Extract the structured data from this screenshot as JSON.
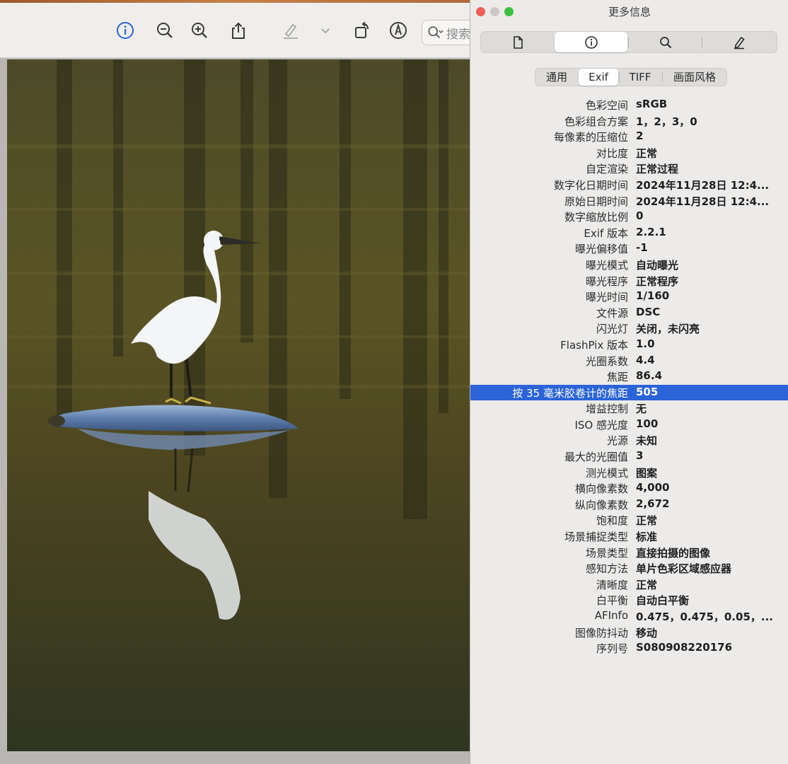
{
  "preview": {
    "search_placeholder": "搜索",
    "toolbar_icons": [
      "info-icon",
      "zoom-out-icon",
      "zoom-in-icon",
      "share-icon",
      "highlight-pen-icon",
      "chevron-down-icon",
      "rotate-icon",
      "markup-icon",
      "search-icon"
    ],
    "photo_description_icon": "egret-photo"
  },
  "inspector": {
    "title": "更多信息",
    "icon_tabs": [
      "document-icon",
      "info-icon",
      "magnifier-icon",
      "pencil-icon"
    ],
    "active_icon_tab": 1,
    "segments": [
      "通用",
      "Exif",
      "TIFF",
      "画面风格"
    ],
    "active_segment": 1,
    "rows": [
      {
        "k": "色彩空间",
        "v": "sRGB"
      },
      {
        "k": "色彩组合方案",
        "v": "1，2，3，0"
      },
      {
        "k": "每像素的压缩位",
        "v": "2"
      },
      {
        "k": "对比度",
        "v": "正常"
      },
      {
        "k": "自定渲染",
        "v": "正常过程"
      },
      {
        "k": "数字化日期时间",
        "v": "2024年11月28日 12:4..."
      },
      {
        "k": "原始日期时间",
        "v": "2024年11月28日 12:4..."
      },
      {
        "k": "数字缩放比例",
        "v": "0"
      },
      {
        "k": "Exif 版本",
        "v": "2.2.1"
      },
      {
        "k": "曝光偏移值",
        "v": "-1"
      },
      {
        "k": "曝光模式",
        "v": "自动曝光"
      },
      {
        "k": "曝光程序",
        "v": "正常程序"
      },
      {
        "k": "曝光时间",
        "v": "1/160"
      },
      {
        "k": "文件源",
        "v": "DSC"
      },
      {
        "k": "闪光灯",
        "v": "关闭，未闪亮"
      },
      {
        "k": "FlashPix 版本",
        "v": "1.0"
      },
      {
        "k": "光圈系数",
        "v": "4.4"
      },
      {
        "k": "焦距",
        "v": "86.4"
      },
      {
        "k": "按 35 毫米胶卷计的焦距",
        "v": "505"
      },
      {
        "k": "增益控制",
        "v": "无"
      },
      {
        "k": "ISO 感光度",
        "v": "100"
      },
      {
        "k": "光源",
        "v": "未知"
      },
      {
        "k": "最大的光圈值",
        "v": "3"
      },
      {
        "k": "测光模式",
        "v": "图案"
      },
      {
        "k": "横向像素数",
        "v": "4,000"
      },
      {
        "k": "纵向像素数",
        "v": "2,672"
      },
      {
        "k": "饱和度",
        "v": "正常"
      },
      {
        "k": "场景捕捉类型",
        "v": "标准"
      },
      {
        "k": "场景类型",
        "v": "直接拍摄的图像"
      },
      {
        "k": "感知方法",
        "v": "单片色彩区域感应器"
      },
      {
        "k": "清晰度",
        "v": "正常"
      },
      {
        "k": "白平衡",
        "v": "自动白平衡"
      },
      {
        "k": "AFInfo",
        "v": "0.475，0.475，0.05，..."
      },
      {
        "k": "图像防抖动",
        "v": "移动"
      },
      {
        "k": "序列号",
        "v": "S080908220176"
      }
    ],
    "selected_row": 18
  },
  "colors": {
    "accent": "#2b63d9",
    "close": "#ee5f57",
    "minimize": "#c9c8c6",
    "zoom": "#3ec03f"
  }
}
